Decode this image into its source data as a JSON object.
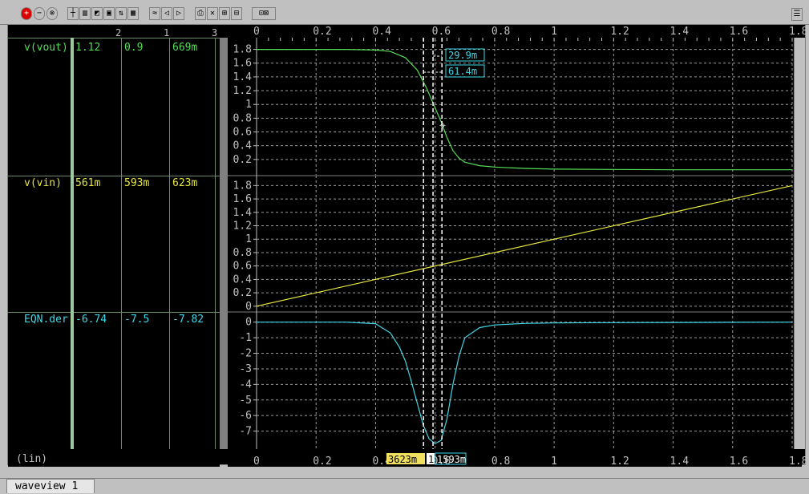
{
  "window": {
    "tab_label": "waveview 1",
    "x_scale_label": "(lin)"
  },
  "columns": {
    "headers": [
      "2",
      "1",
      "3"
    ]
  },
  "rows": [
    {
      "name": "v(vout)",
      "values": [
        "1.12",
        "0.9",
        "669m"
      ],
      "color": "#55dd55"
    },
    {
      "name": "v(vin)",
      "values": [
        "561m",
        "593m",
        "623m"
      ],
      "color": "#e6e640"
    },
    {
      "name": "EQN.der",
      "values": [
        "-6.74",
        "-7.5",
        "-7.82"
      ],
      "color": "#40d8e6"
    }
  ],
  "cursors": {
    "delta_labels": [
      "29.9m",
      "61.4m"
    ],
    "bottom_labels": [
      "3623m",
      "1",
      "1593m"
    ]
  },
  "chart_data": {
    "type": "line",
    "xlim": [
      0,
      1.8
    ],
    "xticks": [
      "0",
      "0.2",
      "0.4",
      "0.6",
      "0.8",
      "1",
      "1.2",
      "1.4",
      "1.6",
      "1.8"
    ],
    "grid": true,
    "cursor_x": [
      0.561,
      0.593,
      0.623
    ],
    "panels": [
      {
        "name": "v(vout)",
        "ylim": [
          0,
          1.9
        ],
        "yticks": [
          "1.8",
          "1.6",
          "1.4",
          "1.2",
          "1",
          "0.8",
          "0.6",
          "0.4",
          "0.2"
        ],
        "tick_values": [
          1.8,
          1.6,
          1.4,
          1.2,
          1.0,
          0.8,
          0.6,
          0.4,
          0.2
        ],
        "color": "#55dd55",
        "x": [
          0,
          0.3,
          0.4,
          0.45,
          0.5,
          0.54,
          0.57,
          0.6,
          0.62,
          0.64,
          0.66,
          0.68,
          0.7,
          0.75,
          0.8,
          0.9,
          1.0,
          1.2,
          1.4,
          1.6,
          1.8
        ],
        "y": [
          1.8,
          1.8,
          1.79,
          1.77,
          1.68,
          1.5,
          1.25,
          0.95,
          0.75,
          0.52,
          0.33,
          0.22,
          0.16,
          0.11,
          0.09,
          0.07,
          0.06,
          0.055,
          0.05,
          0.05,
          0.05
        ]
      },
      {
        "name": "v(vin)",
        "ylim": [
          -0.05,
          1.9
        ],
        "yticks": [
          "1.8",
          "1.6",
          "1.4",
          "1.2",
          "1",
          "0.8",
          "0.6",
          "0.4",
          "0.2",
          "0"
        ],
        "tick_values": [
          1.8,
          1.6,
          1.4,
          1.2,
          1.0,
          0.8,
          0.6,
          0.4,
          0.2,
          0.0
        ],
        "color": "#e6e640",
        "x": [
          0,
          1.8
        ],
        "y": [
          0,
          1.8
        ]
      },
      {
        "name": "EQN.der",
        "ylim": [
          -8,
          0.5
        ],
        "yticks": [
          "0",
          "-1",
          "-2",
          "-3",
          "-4",
          "-5",
          "-6",
          "-7"
        ],
        "tick_values": [
          0,
          -1,
          -2,
          -3,
          -4,
          -5,
          -6,
          -7
        ],
        "color": "#40d8e6",
        "x": [
          0,
          0.3,
          0.4,
          0.45,
          0.48,
          0.5,
          0.52,
          0.54,
          0.56,
          0.58,
          0.6,
          0.62,
          0.64,
          0.66,
          0.68,
          0.7,
          0.75,
          0.8,
          0.9,
          1.0,
          1.2,
          1.4,
          1.6,
          1.8
        ],
        "y": [
          0,
          0,
          -0.1,
          -0.7,
          -1.6,
          -2.5,
          -3.8,
          -5.2,
          -6.6,
          -7.5,
          -7.8,
          -7.6,
          -6.2,
          -4.0,
          -2.2,
          -1.0,
          -0.35,
          -0.18,
          -0.08,
          -0.05,
          -0.03,
          -0.02,
          -0.01,
          0
        ]
      }
    ]
  }
}
